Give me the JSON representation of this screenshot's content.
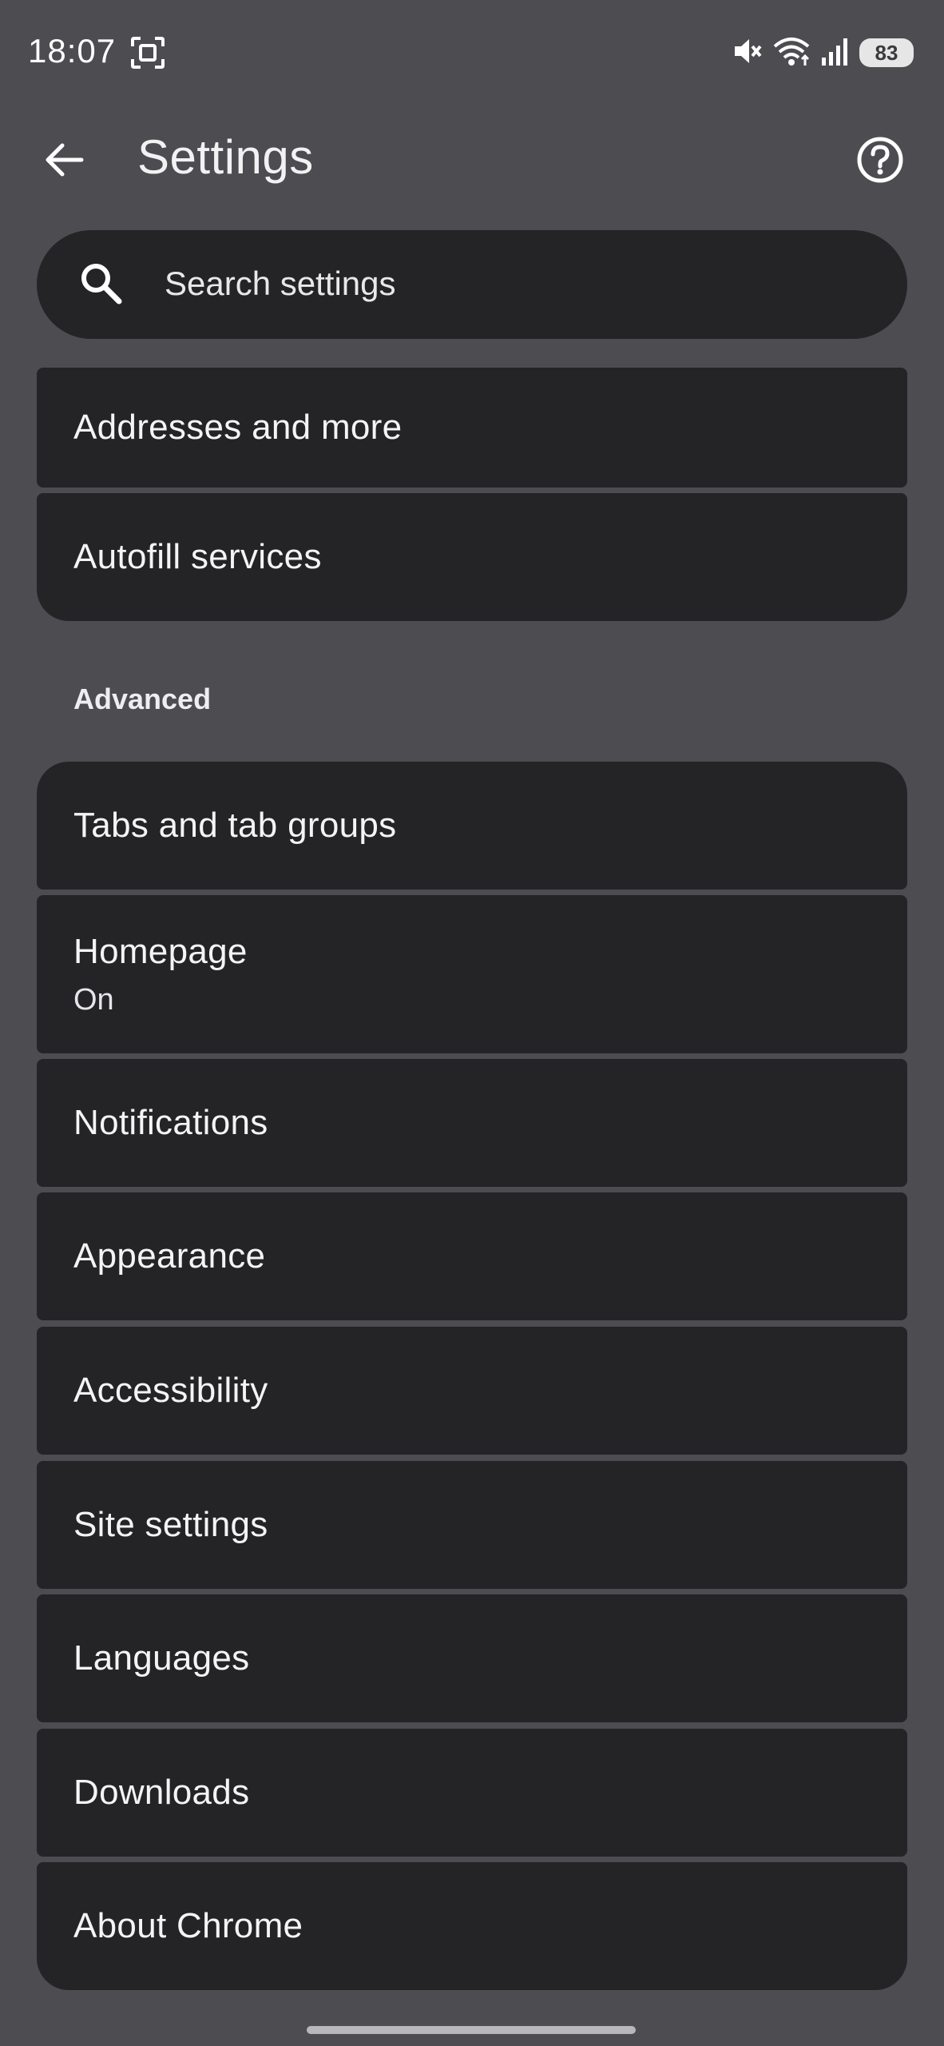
{
  "status_bar": {
    "time": "18:07",
    "battery": "83"
  },
  "app_bar": {
    "title": "Settings"
  },
  "search": {
    "placeholder": "Search settings"
  },
  "autofill_group": [
    {
      "label": "Addresses and more"
    },
    {
      "label": "Autofill services"
    }
  ],
  "advanced": {
    "header": "Advanced",
    "items": [
      {
        "label": "Tabs and tab groups"
      },
      {
        "label": "Homepage",
        "sublabel": "On"
      },
      {
        "label": "Notifications"
      },
      {
        "label": "Appearance"
      },
      {
        "label": "Accessibility"
      },
      {
        "label": "Site settings"
      },
      {
        "label": "Languages"
      },
      {
        "label": "Downloads"
      },
      {
        "label": "About Chrome"
      }
    ]
  },
  "colors": {
    "background": "#4c4c51",
    "card": "#242427",
    "text": "#f4f4f6"
  },
  "icons": [
    "screenshot-icon",
    "mute-icon",
    "wifi-icon",
    "signal-icon",
    "battery-icon",
    "back-arrow-icon",
    "help-icon",
    "search-icon"
  ]
}
